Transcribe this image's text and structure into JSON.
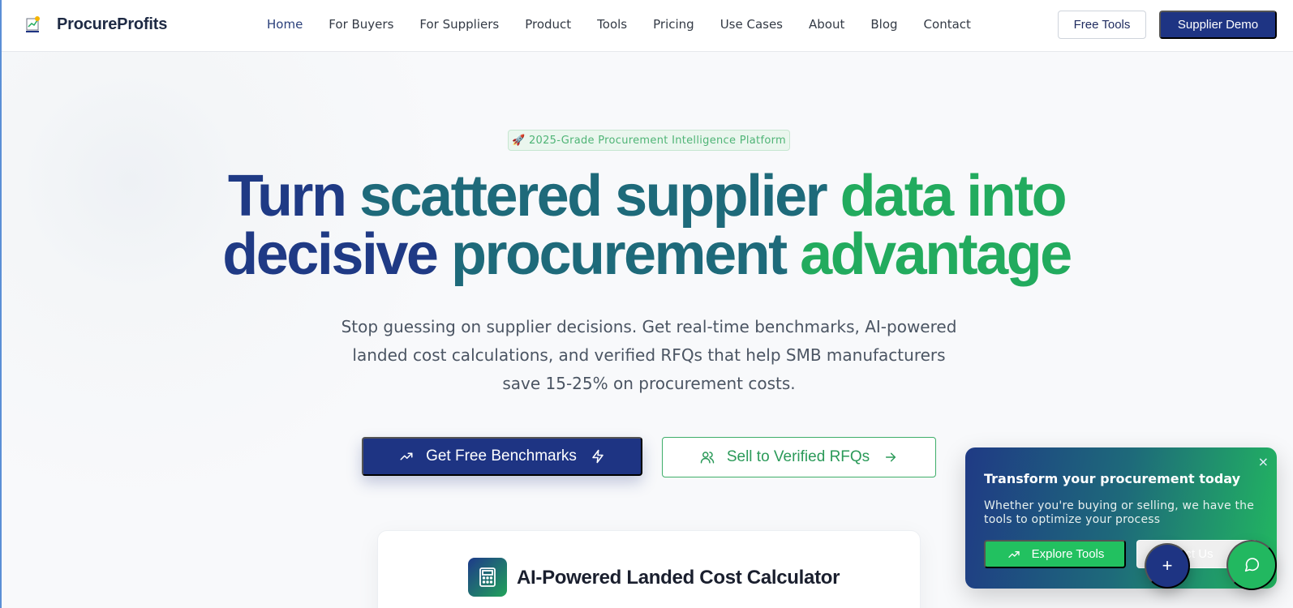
{
  "header": {
    "brand": "ProcureProfits",
    "nav": [
      {
        "label": "Home",
        "active": true
      },
      {
        "label": "For Buyers"
      },
      {
        "label": "For Suppliers"
      },
      {
        "label": "Product"
      },
      {
        "label": "Tools"
      },
      {
        "label": "Pricing"
      },
      {
        "label": "Use Cases"
      },
      {
        "label": "About"
      },
      {
        "label": "Blog"
      },
      {
        "label": "Contact"
      }
    ],
    "free_tools_label": "Free Tools",
    "supplier_demo_label": "Supplier Demo"
  },
  "hero": {
    "badge": "🚀 2025-Grade Procurement Intelligence Platform",
    "title_line1": {
      "part1": "Turn ",
      "part2": "scattered supplier ",
      "part3": "data into"
    },
    "title_line2": {
      "part1": "decisive ",
      "part2": "procurement ",
      "part3": "advantage"
    },
    "subtitle": "Stop guessing on supplier decisions. Get real-time benchmarks, AI-powered landed cost calculations, and verified RFQs that help SMB manufacturers save 15-25% on procurement costs.",
    "cta_primary": "Get Free Benchmarks",
    "cta_secondary": "Sell to Verified RFQs"
  },
  "calculator": {
    "title": "AI-Powered Landed Cost Calculator"
  },
  "popup": {
    "close": "×",
    "title": "Transform your procurement today",
    "text": "Whether you're buying or selling, we have the tools to optimize your process",
    "explore_label": "Explore Tools",
    "contact_label": "Contact Us"
  },
  "fab": {
    "plus": "+"
  },
  "colors": {
    "navy": "#1e3483",
    "teal": "#1e6a7a",
    "green": "#22ab5e"
  },
  "icons": [
    "trend-up-icon",
    "lightning-icon",
    "users-icon",
    "arrow-right-icon",
    "calculator-icon",
    "close-icon",
    "plus-icon",
    "chat-icon"
  ]
}
